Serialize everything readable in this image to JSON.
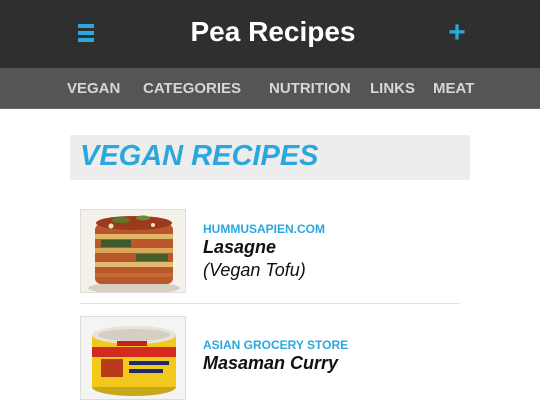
{
  "header": {
    "title": "Pea Recipes",
    "menu_icon": "hamburger-menu-icon",
    "add_icon": "plus-icon",
    "add_label": "+",
    "accent_color": "#2aa8de",
    "background_color": "#2f2f2f"
  },
  "nav": {
    "items": [
      {
        "label": "VEGAN"
      },
      {
        "label": "CATEGORIES"
      },
      {
        "label": "NUTRITION"
      },
      {
        "label": "LINKS"
      },
      {
        "label": "MEAT"
      }
    ]
  },
  "section": {
    "title": "VEGAN RECIPES"
  },
  "recipes": [
    {
      "source": "HUMMUSAPIEN.COM",
      "name": "Lasagne",
      "subtitle": "(Vegan Tofu)",
      "image": "lasagne-photo"
    },
    {
      "source": "ASIAN GROCERY STORE",
      "name": "Masaman Curry",
      "subtitle": "",
      "image": "curry-paste-can-photo"
    }
  ]
}
